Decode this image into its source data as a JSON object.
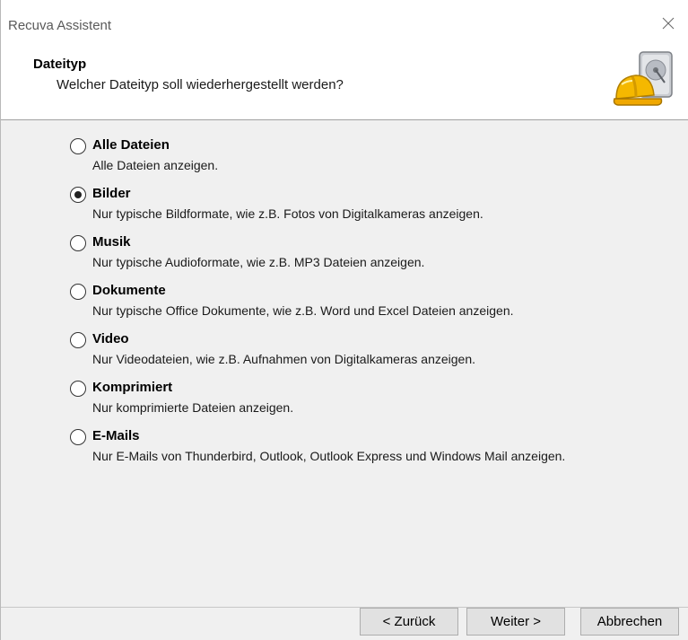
{
  "window": {
    "title": "Recuva Assistent"
  },
  "header": {
    "title": "Dateityp",
    "subtitle": "Welcher Dateityp soll wiederhergestellt werden?"
  },
  "options": [
    {
      "label": "Alle Dateien",
      "description": "Alle Dateien anzeigen.",
      "checked": false
    },
    {
      "label": "Bilder",
      "description": "Nur typische Bildformate, wie z.B. Fotos von Digitalkameras anzeigen.",
      "checked": true
    },
    {
      "label": "Musik",
      "description": "Nur typische Audioformate, wie z.B. MP3 Dateien anzeigen.",
      "checked": false
    },
    {
      "label": "Dokumente",
      "description": "Nur typische Office Dokumente, wie z.B. Word und Excel Dateien anzeigen.",
      "checked": false
    },
    {
      "label": "Video",
      "description": "Nur Videodateien, wie z.B. Aufnahmen von Digitalkameras anzeigen.",
      "checked": false
    },
    {
      "label": "Komprimiert",
      "description": "Nur komprimierte Dateien anzeigen.",
      "checked": false
    },
    {
      "label": "E-Mails",
      "description": "Nur E-Mails von Thunderbird, Outlook, Outlook Express und Windows Mail anzeigen.",
      "checked": false
    }
  ],
  "footer": {
    "back_label": "< Zurück",
    "next_label": "Weiter >",
    "cancel_label": "Abbrechen"
  },
  "icons": {
    "close": "close-icon",
    "logo": "recuva-logo-icon"
  }
}
